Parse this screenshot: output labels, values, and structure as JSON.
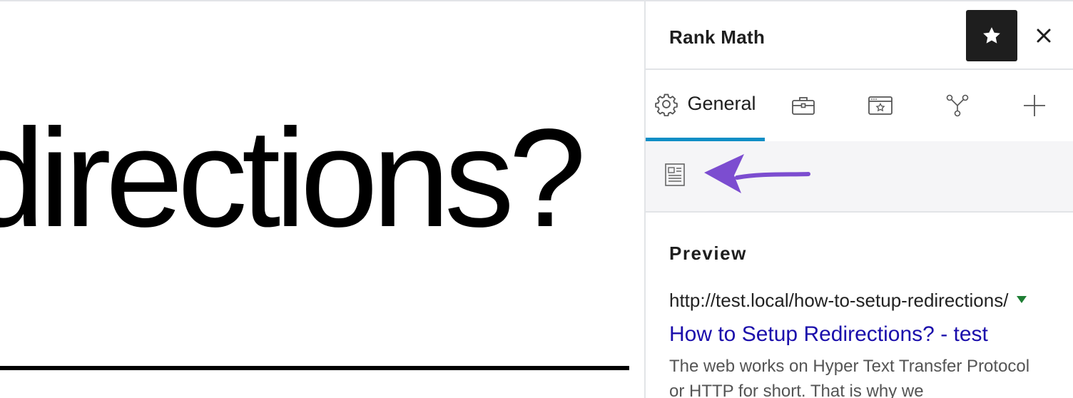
{
  "editor": {
    "headline_text": "directions?"
  },
  "sidebar": {
    "title": "Rank Math",
    "header_icons": [
      "star-icon",
      "close-icon"
    ],
    "tabs": [
      {
        "label": "General",
        "icon": "gear-icon",
        "active": true
      },
      {
        "label": "",
        "icon": "toolbox-icon",
        "active": false
      },
      {
        "label": "",
        "icon": "schema-browser-icon",
        "active": false
      },
      {
        "label": "",
        "icon": "social-share-icon",
        "active": false
      },
      {
        "label": "",
        "icon": "plus-icon",
        "active": false
      }
    ],
    "subtoolbar": {
      "icon": "snippet-editor-icon",
      "annotation": "purple-arrow"
    },
    "preview": {
      "heading": "Preview",
      "url": "http://test.local/how-to-setup-redirections/",
      "link_title": "How to Setup Redirections? - test",
      "description": "The web works on Hyper Text Transfer Protocol or HTTP for short. That is why we"
    }
  },
  "colors": {
    "active_tab_underline": "#0f8ec5",
    "star_button_bg": "#1e1e1e",
    "link": "#1a0dab",
    "url_caret": "#1e7e34",
    "arrow": "#7c4dd0",
    "subtoolbar_bg": "#f5f5f7"
  }
}
